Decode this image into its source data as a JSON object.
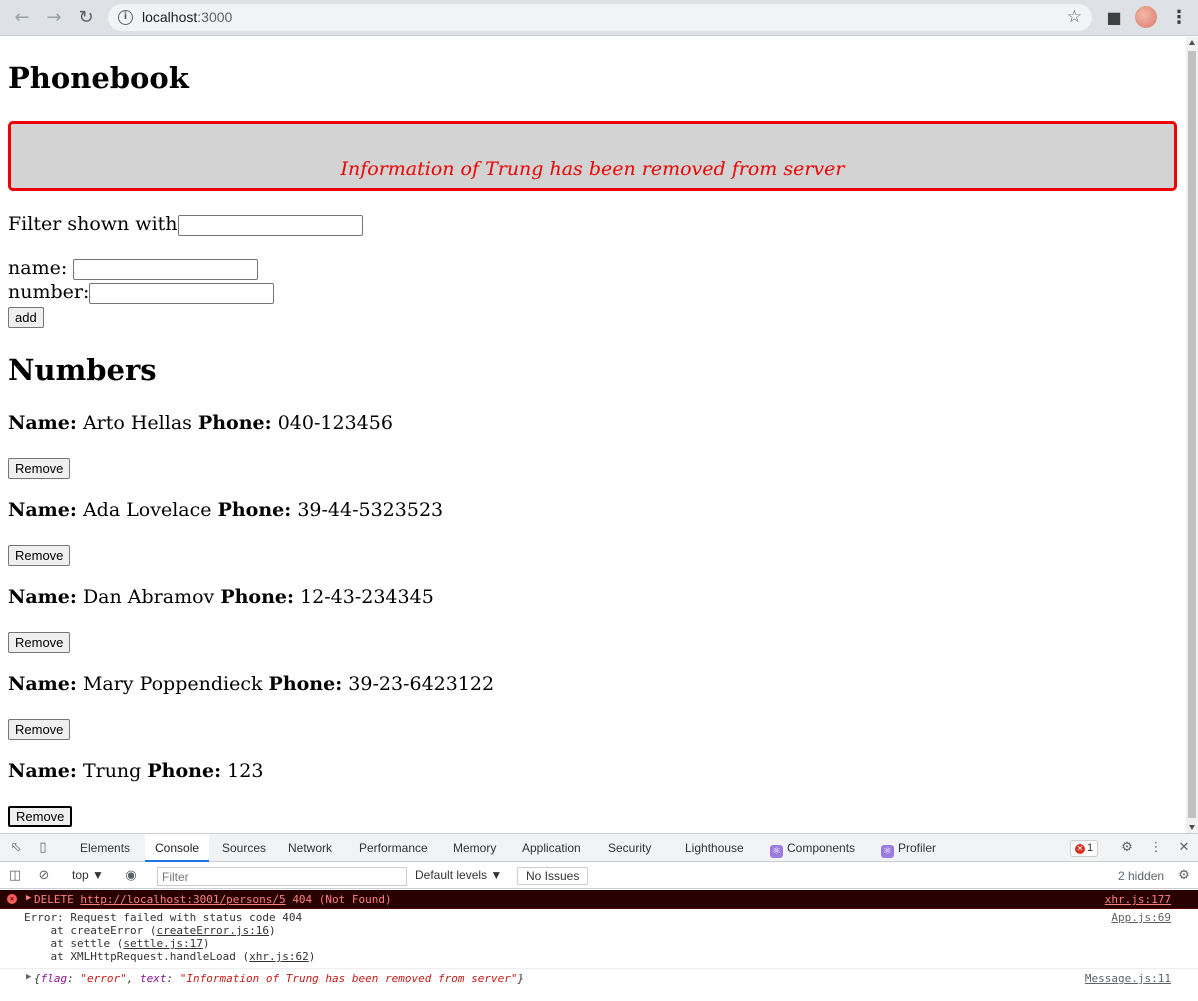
{
  "browser": {
    "url_host": "localhost",
    "url_port": ":3000"
  },
  "app": {
    "title": "Phonebook",
    "notification": "Information of Trung has been removed from server",
    "filter_label": "Filter shown with",
    "filter_value": "",
    "name_label": "name:",
    "name_value": "",
    "number_label": "number:",
    "number_value": "",
    "add_label": "add",
    "numbers_title": "Numbers",
    "name_key": "Name:",
    "phone_key": "Phone:",
    "remove_label": "Remove",
    "persons": [
      {
        "name": "Arto Hellas",
        "phone": "040-123456"
      },
      {
        "name": "Ada Lovelace",
        "phone": "39-44-5323523"
      },
      {
        "name": "Dan Abramov",
        "phone": "12-43-234345"
      },
      {
        "name": "Mary Poppendieck",
        "phone": "39-23-6423122"
      },
      {
        "name": "Trung",
        "phone": "123"
      }
    ]
  },
  "devtools": {
    "tabs": [
      "Elements",
      "Console",
      "Sources",
      "Network",
      "Performance",
      "Memory",
      "Application",
      "Security",
      "Lighthouse",
      "Components",
      "Profiler"
    ],
    "active_tab": "Console",
    "error_count": "1",
    "context": "top",
    "filter_placeholder": "Filter",
    "levels": "Default levels",
    "issues": "No Issues",
    "hidden": "2 hidden",
    "console": {
      "error_method": "DELETE",
      "error_url": "http://localhost:3001/persons/5",
      "error_status": "404 (Not Found)",
      "error_src": "xhr.js:177",
      "stack_l1": "Error: Request failed with status code 404",
      "stack_l2_pre": "    at createError (",
      "stack_l2_link": "createError.js:16",
      "stack_l3_pre": "    at settle (",
      "stack_l3_link": "settle.js:17",
      "stack_l4_pre": "    at XMLHttpRequest.handleLoad (",
      "stack_l4_link": "xhr.js:62",
      "stack_src": "App.js:69",
      "obj_flag_key": "flag",
      "obj_flag_val": "\"error\"",
      "obj_text_key": "text",
      "obj_text_val": "\"Information of Trung has been removed from server\"",
      "obj_src": "Message.js:11"
    }
  }
}
